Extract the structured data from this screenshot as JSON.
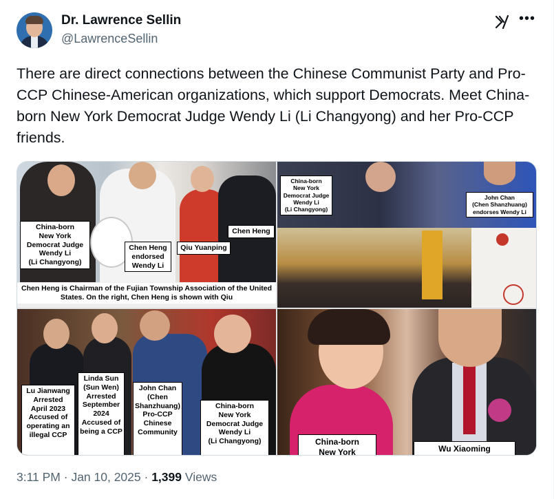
{
  "author": {
    "name": "Dr. Lawrence Sellin",
    "handle": "@LawrenceSellin"
  },
  "post_text": "There are direct connections between the Chinese Communist Party and Pro-CCP Chinese-American organizations, which support Democrats. Meet China-born New York Democrat Judge Wendy Li (Li Changyong) and her Pro-CCP friends.",
  "image": {
    "tile1": {
      "caption_wendy": "China-born\nNew York\nDemocrat Judge\nWendy Li\n(Li Changyong)",
      "caption_chen_endorsed": "Chen Heng\nendorsed\nWendy Li",
      "caption_qiu": "Qiu Yuanping",
      "caption_chen": "Chen Heng",
      "caption_bottom": "Chen Heng is Chairman of the Fujian Township Association of the United States. On the right, Chen Heng is shown with Qiu"
    },
    "tile2": {
      "caption_wendy": "China-born\nNew York\nDemocrat Judge\nWendy Li\n(Li Changyong)",
      "caption_john": "John Chan\n(Chen Shanzhuang)\nendorses Wendy Li"
    },
    "tile3": {
      "caption_lu": "Lu Jianwang\nArrested\nApril 2023\nAccused of\noperating an\nillegal CCP",
      "caption_linda": "Linda Sun\n(Sun Wen)\nArrested\nSeptember\n2024\nAccused of\nbeing a CCP",
      "caption_john": "John Chan\n(Chen\nShanzhuang)\nPro-CCP\nChinese\nCommunity",
      "caption_wendy": "China-born\nNew York\nDemocrat Judge\nWendy Li\n(Li Changyong)"
    },
    "tile4": {
      "caption_china": "China-born\nNew York",
      "caption_wu": "Wu Xiaoming"
    }
  },
  "meta": {
    "time": "3:11 PM",
    "separator": " · ",
    "date": "Jan 10, 2025",
    "views_count": "1,399",
    "views_label": " Views"
  },
  "icons": {
    "grok": "grok-icon",
    "more": "more-icon"
  }
}
